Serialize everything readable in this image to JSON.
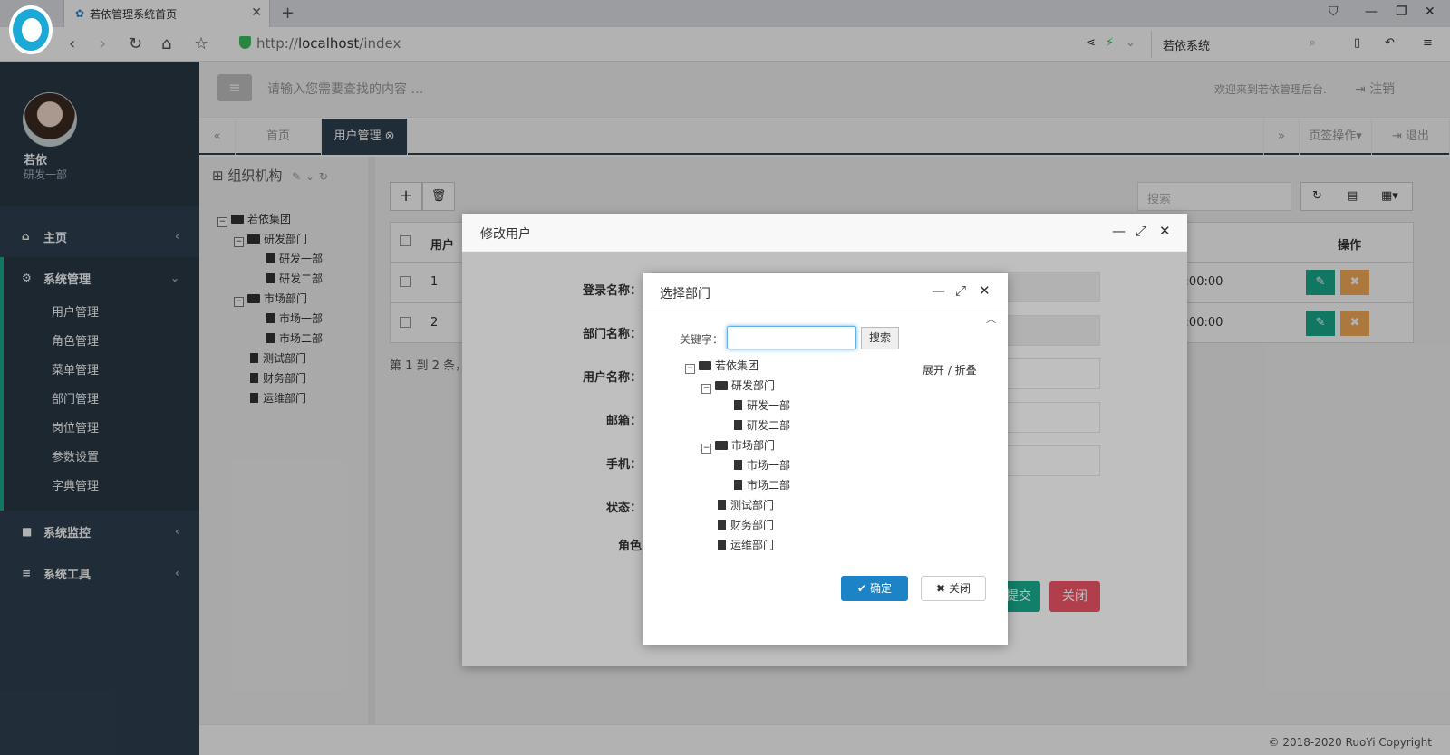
{
  "browser": {
    "tab_title": "若依管理系统首页",
    "url_proto": "http://",
    "url_host": "localhost",
    "url_path": "/index",
    "search_text": "若依系统"
  },
  "sidebar": {
    "user_name": "若依",
    "user_dept": "研发一部",
    "menu": [
      {
        "label": "主页"
      },
      {
        "label": "系统管理"
      },
      {
        "label": "系统监控"
      },
      {
        "label": "系统工具"
      }
    ],
    "submenu": [
      "用户管理",
      "角色管理",
      "菜单管理",
      "部门管理",
      "岗位管理",
      "参数设置",
      "字典管理"
    ]
  },
  "topbar": {
    "search_placeholder": "请输入您需要查找的内容 …",
    "welcome": "欢迎来到若依管理后台.",
    "logout": "注销"
  },
  "tabs": {
    "home": "首页",
    "active": "用户管理",
    "page_ops": "页签操作",
    "exit": "退出"
  },
  "org": {
    "title": "组织机构",
    "tree": [
      "若依集团",
      "研发部门",
      "研发一部",
      "研发二部",
      "市场部门",
      "市场一部",
      "市场二部",
      "测试部门",
      "财务部门",
      "运维部门"
    ]
  },
  "table": {
    "search_placeholder": "搜索",
    "col_user": "用户",
    "col_ops": "操作",
    "rows": [
      {
        "id": "1",
        "time": "00:00:00"
      },
      {
        "id": "2",
        "time": "00:00:00"
      }
    ],
    "pagination": "第 1 到 2 条，"
  },
  "footer": {
    "copyright": "© 2018-2020 RuoYi Copyright"
  },
  "dialog_edit": {
    "title": "修改用户",
    "labels": [
      "登录名称：",
      "部门名称：",
      "用户名称：",
      "邮箱：",
      "手机：",
      "状态：",
      "角色"
    ],
    "submit": "提交",
    "close": "关闭"
  },
  "dialog_dept": {
    "title": "选择部门",
    "keyword_label": "关键字：",
    "search_btn": "搜索",
    "expand_collapse": "展开 / 折叠",
    "confirm": "确定",
    "close": "关闭"
  },
  "colors": {
    "sidebar": "#2f4050",
    "accent": "#19aa8d",
    "primary": "#1c84c6",
    "warning": "#f8ac59",
    "danger": "#ed5565"
  }
}
